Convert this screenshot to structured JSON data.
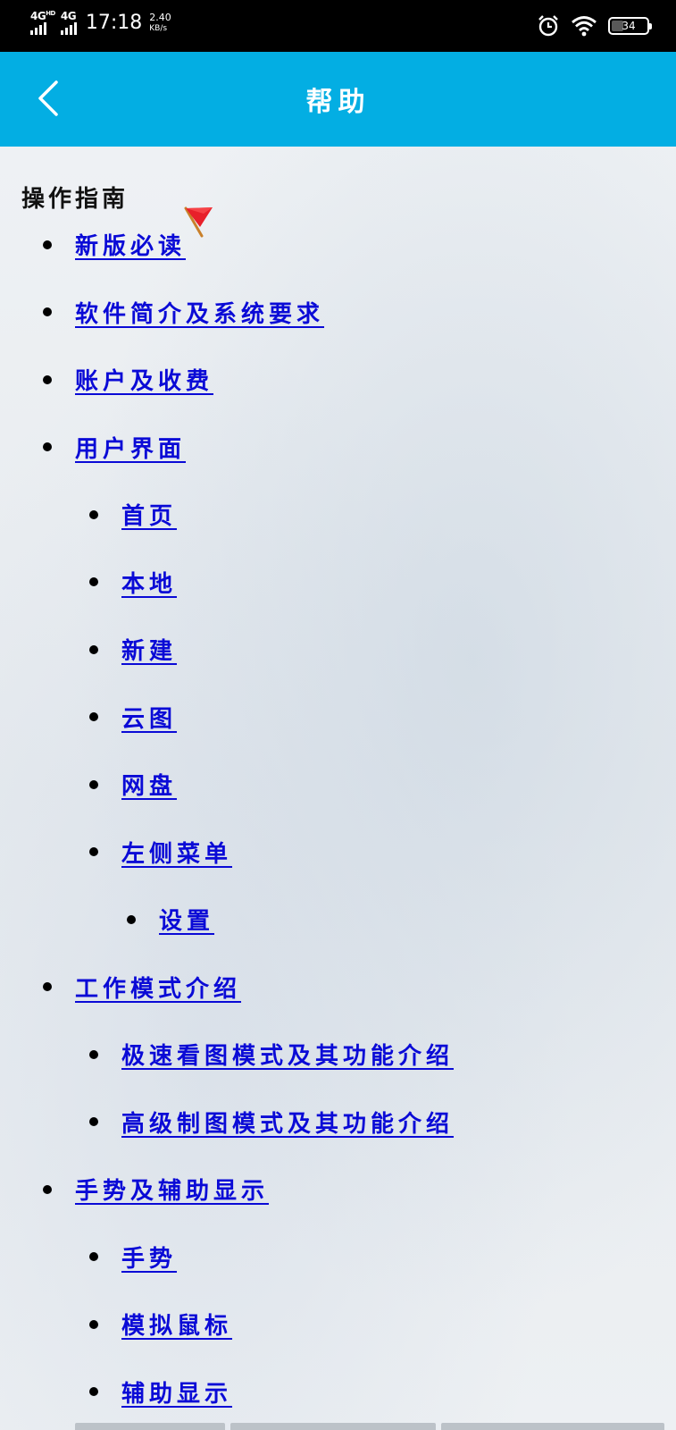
{
  "status_bar": {
    "network1": "4G",
    "network1_sup": "HD",
    "network2": "4G",
    "time": "17:18",
    "speed_value": "2.40",
    "speed_unit": "KB/s",
    "battery": "34",
    "battery_level": 0.34,
    "icons": [
      "alarm-icon",
      "wifi-icon",
      "battery-icon"
    ]
  },
  "header": {
    "title": "帮助",
    "back_icon": "chevron-left-icon",
    "background": "#03aee3"
  },
  "content": {
    "section_heading": "操作指南",
    "link_color": "#0a0ad6",
    "items": [
      {
        "level": 1,
        "label": "新版必读",
        "flag": true
      },
      {
        "level": 1,
        "label": "软件简介及系统要求"
      },
      {
        "level": 1,
        "label": "账户及收费"
      },
      {
        "level": 1,
        "label": "用户界面"
      },
      {
        "level": 2,
        "label": "首页"
      },
      {
        "level": 2,
        "label": "本地"
      },
      {
        "level": 2,
        "label": "新建"
      },
      {
        "level": 2,
        "label": "云图"
      },
      {
        "level": 2,
        "label": "网盘"
      },
      {
        "level": 2,
        "label": "左侧菜单"
      },
      {
        "level": 3,
        "label": "设置"
      },
      {
        "level": 1,
        "label": "工作模式介绍"
      },
      {
        "level": 2,
        "label": "极速看图模式及其功能介绍"
      },
      {
        "level": 2,
        "label": "高级制图模式及其功能介绍"
      },
      {
        "level": 1,
        "label": "手势及辅助显示"
      },
      {
        "level": 2,
        "label": "手势"
      },
      {
        "level": 2,
        "label": "模拟鼠标"
      },
      {
        "level": 2,
        "label": "辅助显示"
      }
    ]
  }
}
